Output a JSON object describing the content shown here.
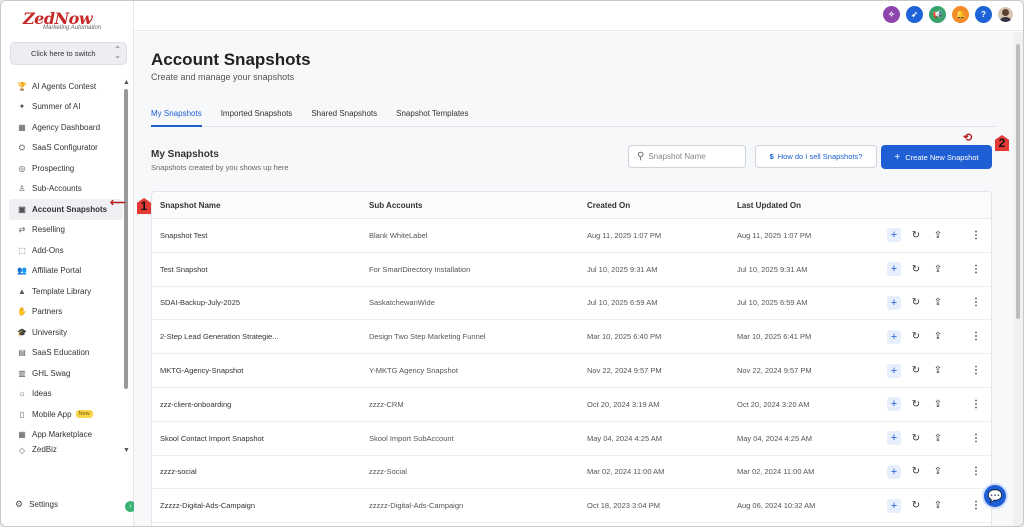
{
  "brand": {
    "logo_main": "ZedNow",
    "logo_tagline": "Marketing Automation"
  },
  "sidebar": {
    "switcher_label": "Click here to switch",
    "items": [
      {
        "label": "AI Agents Contest",
        "icon": "trophy-icon"
      },
      {
        "label": "Summer of AI",
        "icon": "sparkle-icon"
      },
      {
        "label": "Agency Dashboard",
        "icon": "dashboard-icon"
      },
      {
        "label": "SaaS Configurator",
        "icon": "config-icon"
      },
      {
        "label": "Prospecting",
        "icon": "target-icon"
      },
      {
        "label": "Sub-Accounts",
        "icon": "user-icon"
      },
      {
        "label": "Account Snapshots",
        "icon": "snapshot-icon",
        "active": true
      },
      {
        "label": "Reselling",
        "icon": "reselling-icon"
      },
      {
        "label": "Add-Ons",
        "icon": "addons-icon"
      },
      {
        "label": "Affiliate Portal",
        "icon": "people-icon"
      },
      {
        "label": "Template Library",
        "icon": "shapes-icon"
      },
      {
        "label": "Partners",
        "icon": "handshake-icon"
      },
      {
        "label": "University",
        "icon": "graduation-cap-icon"
      },
      {
        "label": "SaaS Education",
        "icon": "education-icon"
      },
      {
        "label": "GHL Swag",
        "icon": "swag-icon"
      },
      {
        "label": "Ideas",
        "icon": "bulb-icon"
      },
      {
        "label": "Mobile App",
        "icon": "mobile-icon",
        "badge": "New"
      },
      {
        "label": "App Marketplace",
        "icon": "grid-icon"
      },
      {
        "label": "ZedBiz",
        "icon": "biz-icon"
      }
    ],
    "settings_label": "Settings"
  },
  "header": {
    "icons": [
      "ai-icon",
      "rocket-icon",
      "megaphone-icon",
      "bell-icon",
      "help-icon",
      "avatar"
    ],
    "colors": {
      "ai": "#8e44ad",
      "rocket": "#1e63d8",
      "megaphone": "#3aa36b",
      "bell": "#f28c28",
      "help": "#1e63d8"
    }
  },
  "page": {
    "title": "Account Snapshots",
    "subtitle": "Create and manage your snapshots",
    "tabs": [
      "My Snapshots",
      "Imported Snapshots",
      "Shared Snapshots",
      "Snapshot Templates"
    ],
    "active_tab": "My Snapshots",
    "section_title": "My Snapshots",
    "section_subtitle": "Snapshots created by you shows up here",
    "search_placeholder": "Snapshot Name",
    "how_button": "How do I sell Snapshots?",
    "create_button": "Create New Snapshot",
    "accent": "#1f5fd6"
  },
  "table": {
    "columns": [
      "Snapshot Name",
      "Sub Accounts",
      "Created On",
      "Last Updated On"
    ],
    "rows": [
      [
        "Snapshot Test",
        "Blank WhiteLabel",
        "Aug 11, 2025 1:07 PM",
        "Aug 11, 2025 1:07 PM"
      ],
      [
        "Test Snapshot",
        "For SmartDirectory Installation",
        "Jul 10, 2025 9:31 AM",
        "Jul 10, 2025 9:31 AM"
      ],
      [
        "SDAI-Backup-July-2025",
        "SaskatchewanWide",
        "Jul 10, 2025 6:59 AM",
        "Jul 10, 2025 6:59 AM"
      ],
      [
        "2-Step Lead Generation Strategie...",
        "Design Two Step Marketing Funnel",
        "Mar 10, 2025 6:40 PM",
        "Mar 10, 2025 6:41 PM"
      ],
      [
        "MKTG-Agency-Snapshot",
        "Y-MKTG Agency Snapshot",
        "Nov 22, 2024 9:57 PM",
        "Nov 22, 2024 9:57 PM"
      ],
      [
        "zzz-client-onboarding",
        "zzzz-CRM",
        "Oct 20, 2024 3:19 AM",
        "Oct 20, 2024 3:20 AM"
      ],
      [
        "Skool Contact Import Snapshot",
        "Skool Import SubAccount",
        "May 04, 2024 4:25 AM",
        "May 04, 2024 4:25 AM"
      ],
      [
        "zzzz-social",
        "zzzz-Social",
        "Mar 02, 2024 11:00 AM",
        "Mar 02, 2024 11:00 AM"
      ],
      [
        "Zzzzz-Digital-Ads-Campaign",
        "zzzzz-Digital-Ads-Campaign",
        "Oct 18, 2023 3:04 PM",
        "Aug 06, 2024 10:32 AM"
      ]
    ]
  },
  "annotations": {
    "marker_1": "1",
    "marker_2": "2"
  }
}
